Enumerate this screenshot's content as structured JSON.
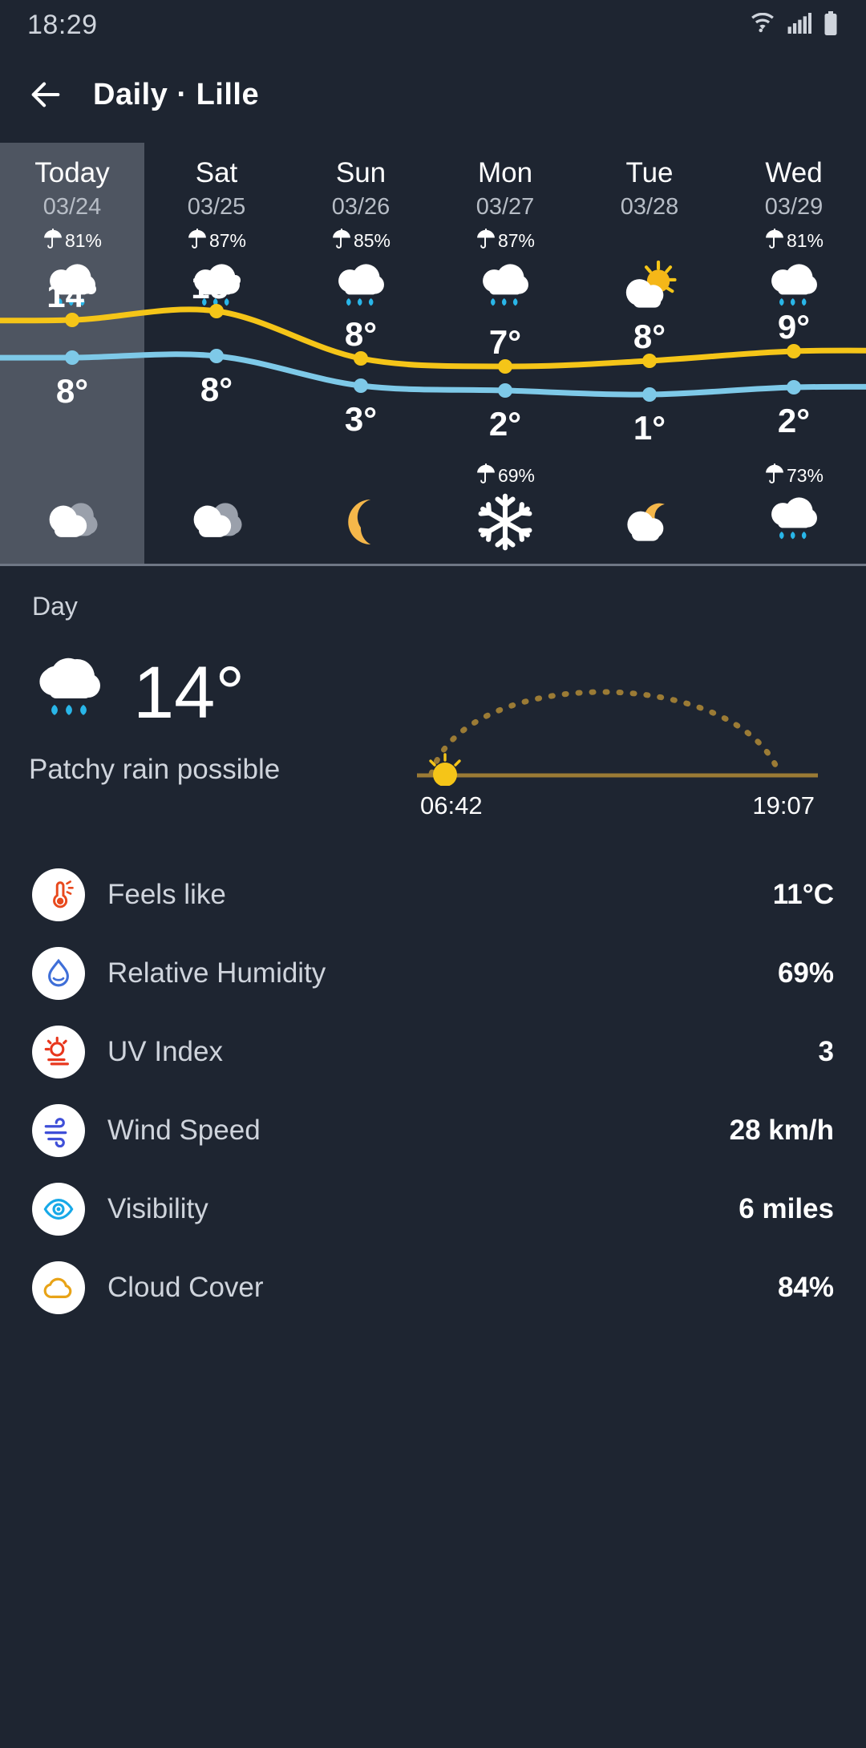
{
  "status_bar": {
    "time": "18:29",
    "icons": [
      "wifi-icon",
      "cellular-signal-icon",
      "battery-icon"
    ]
  },
  "app_bar": {
    "back_icon": "back-arrow-icon",
    "title": "Daily · Lille"
  },
  "forecast": {
    "days": [
      {
        "name": "Today",
        "date": "03/24",
        "pop_day": "81%",
        "icon_day": "rain-cloud-icon",
        "high": "14°",
        "low": "8°",
        "pop_night": "",
        "icon_night": "cloudy-icon",
        "selected": true
      },
      {
        "name": "Sat",
        "date": "03/25",
        "pop_day": "87%",
        "icon_day": "rain-cloud-icon",
        "high": "15°",
        "low": "8°",
        "pop_night": "",
        "icon_night": "cloudy-icon",
        "selected": false
      },
      {
        "name": "Sun",
        "date": "03/26",
        "pop_day": "85%",
        "icon_day": "rain-cloud-icon",
        "high": "8°",
        "low": "3°",
        "pop_night": "",
        "icon_night": "moon-icon",
        "selected": false
      },
      {
        "name": "Mon",
        "date": "03/27",
        "pop_day": "87%",
        "icon_day": "rain-cloud-icon",
        "high": "7°",
        "low": "2°",
        "pop_night": "69%",
        "icon_night": "snowflake-icon",
        "selected": false
      },
      {
        "name": "Tue",
        "date": "03/28",
        "pop_day": "",
        "icon_day": "sun-behind-cloud-icon",
        "high": "8°",
        "low": "1°",
        "pop_night": "",
        "icon_night": "moon-behind-cloud-icon",
        "selected": false
      },
      {
        "name": "Wed",
        "date": "03/29",
        "pop_day": "81%",
        "icon_day": "rain-cloud-icon",
        "high": "9°",
        "low": "2°",
        "pop_night": "73%",
        "icon_night": "rain-cloud-icon",
        "selected": false
      }
    ],
    "umbrella_icon": "umbrella-icon",
    "high_line_color": "#f5c518",
    "low_line_color": "#7ec9e8"
  },
  "chart_data": {
    "type": "line",
    "title": "",
    "categories": [
      "Today 03/24",
      "Sat 03/25",
      "Sun 03/26",
      "Mon 03/27",
      "Tue 03/28",
      "Wed 03/29"
    ],
    "series": [
      {
        "name": "High",
        "values": [
          14,
          15,
          8,
          7,
          8,
          9
        ],
        "color": "#f5c518"
      },
      {
        "name": "Low",
        "values": [
          8,
          8,
          3,
          2,
          1,
          2
        ],
        "color": "#7ec9e8"
      }
    ],
    "ylabel": "°C",
    "xlabel": "",
    "ylim": [
      0,
      16
    ],
    "grid": false,
    "legend": "none",
    "annotations": [
      {
        "label": "precipitation chance day",
        "values": [
          "81%",
          "87%",
          "85%",
          "87%",
          "",
          "81%"
        ]
      },
      {
        "label": "precipitation chance night",
        "values": [
          "",
          "",
          "",
          "69%",
          "",
          "73%"
        ]
      }
    ]
  },
  "detail": {
    "section_label": "Day",
    "icon": "rain-cloud-icon",
    "temperature": "14°",
    "condition": "Patchy rain possible",
    "sunrise": "06:42",
    "sunset": "19:07",
    "sun_arc_color": "#9b7b35",
    "sun_icon": "sunrise-icon"
  },
  "metrics": [
    {
      "icon": "thermometer-icon",
      "label": "Feels like",
      "value": "11°C",
      "color": "#e8491d"
    },
    {
      "icon": "water-drop-icon",
      "label": "Relative Humidity",
      "value": "69%",
      "color": "#3f6fd8"
    },
    {
      "icon": "uv-sun-icon",
      "label": "UV Index",
      "value": "3",
      "color": "#e8371d"
    },
    {
      "icon": "wind-icon",
      "label": "Wind Speed",
      "value": "28 km/h",
      "color": "#3f4fd8"
    },
    {
      "icon": "eye-icon",
      "label": "Visibility",
      "value": "6 miles",
      "color": "#17a9e8"
    },
    {
      "icon": "cloud-outline-icon",
      "label": "Cloud Cover",
      "value": "84%",
      "color": "#e8a317"
    }
  ]
}
